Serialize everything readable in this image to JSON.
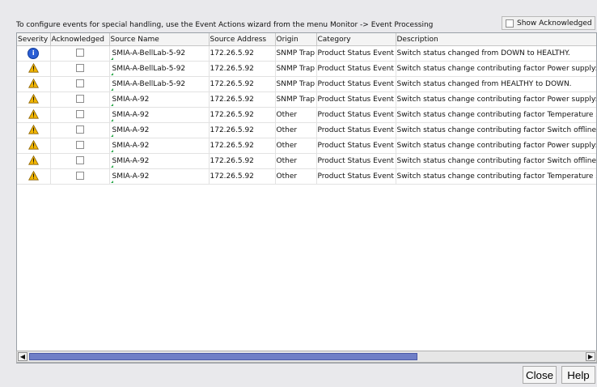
{
  "message": "To configure events for special handling, use the Event Actions wizard from the menu Monitor -> Event Processing",
  "show_acknowledged": {
    "label": "Show Acknowledged",
    "checked": false
  },
  "table": {
    "headers": [
      "Severity",
      "Acknowledged",
      "Source Name",
      "Source Address",
      "Origin",
      "Category",
      "Description"
    ],
    "rows": [
      {
        "severity": "info",
        "acknowledged": false,
        "source_name": "SMIA-A-BellLab-5-92",
        "source_address": "172.26.5.92",
        "origin": "SNMP Trap",
        "category": "Product Status Event",
        "description": "Switch status changed from DOWN to HEALTHY."
      },
      {
        "severity": "warning",
        "acknowledged": false,
        "source_name": "SMIA-A-BellLab-5-92",
        "source_address": "172.26.5.92",
        "origin": "SNMP Trap",
        "category": "Product Status Event",
        "description": "Switch status change contributing factor Power supply:"
      },
      {
        "severity": "warning",
        "acknowledged": false,
        "source_name": "SMIA-A-BellLab-5-92",
        "source_address": "172.26.5.92",
        "origin": "SNMP Trap",
        "category": "Product Status Event",
        "description": "Switch status changed from HEALTHY to DOWN."
      },
      {
        "severity": "warning",
        "acknowledged": false,
        "source_name": "SMIA-A-92",
        "source_address": "172.26.5.92",
        "origin": "SNMP Trap",
        "category": "Product Status Event",
        "description": "Switch status change contributing factor Power supply:"
      },
      {
        "severity": "warning",
        "acknowledged": false,
        "source_name": "SMIA-A-92",
        "source_address": "172.26.5.92",
        "origin": "Other",
        "category": "Product Status Event",
        "description": "Switch status change contributing factor Temperature se"
      },
      {
        "severity": "warning",
        "acknowledged": false,
        "source_name": "SMIA-A-92",
        "source_address": "172.26.5.92",
        "origin": "Other",
        "category": "Product Status Event",
        "description": "Switch status change contributing factor Switch offline."
      },
      {
        "severity": "warning",
        "acknowledged": false,
        "source_name": "SMIA-A-92",
        "source_address": "172.26.5.92",
        "origin": "Other",
        "category": "Product Status Event",
        "description": "Switch status change contributing factor Power supply:"
      },
      {
        "severity": "warning",
        "acknowledged": false,
        "source_name": "SMIA-A-92",
        "source_address": "172.26.5.92",
        "origin": "Other",
        "category": "Product Status Event",
        "description": "Switch status change contributing factor Switch offline."
      },
      {
        "severity": "warning",
        "acknowledged": false,
        "source_name": "SMIA-A-92",
        "source_address": "172.26.5.92",
        "origin": "Other",
        "category": "Product Status Event",
        "description": "Switch status change contributing factor Temperature se"
      }
    ]
  },
  "buttons": {
    "close": "Close",
    "help": "Help"
  },
  "icons": {
    "info": "info-icon",
    "warning": "warning-icon",
    "scroll_left": "left-arrow-icon",
    "scroll_right": "right-arrow-icon"
  },
  "colors": {
    "info_icon": "#2b5fd5",
    "warning_icon": "#f2b600",
    "scroll_thumb": "#6f7fc7",
    "source_marker": "#2aa84a"
  }
}
